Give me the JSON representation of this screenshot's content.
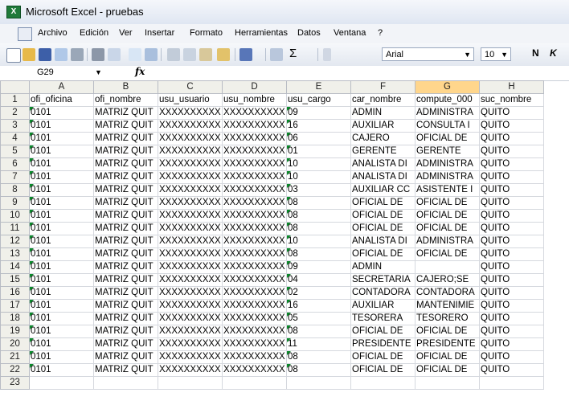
{
  "window": {
    "title": "Microsoft Excel - pruebas"
  },
  "menu": [
    "Archivo",
    "Edición",
    "Ver",
    "Insertar",
    "Formato",
    "Herramientas",
    "Datos",
    "Ventana",
    "?"
  ],
  "toolbar": {
    "font": "Arial",
    "size": "10",
    "bold": "N",
    "italic": "K",
    "sum": "Σ"
  },
  "formula_bar": {
    "cell_ref": "G29",
    "fx": "fx",
    "value": ""
  },
  "columns": [
    "A",
    "B",
    "C",
    "D",
    "E",
    "F",
    "G",
    "H"
  ],
  "rows": [
    [
      "ofi_oficina",
      "ofi_nombre",
      "usu_usuario",
      "usu_nombre",
      "usu_cargo",
      "car_nombre",
      "compute_000",
      "suc_nombre"
    ],
    [
      "0101",
      "MATRIZ QUIT",
      "XXXXXXXXXX",
      "XXXXXXXXXX",
      "09",
      "ADMIN",
      "ADMINISTRA",
      "QUITO"
    ],
    [
      "0101",
      "MATRIZ QUIT",
      "XXXXXXXXXX",
      "XXXXXXXXXX",
      "16",
      "AUXILIAR",
      "CONSULTA I",
      "QUITO"
    ],
    [
      "0101",
      "MATRIZ QUIT",
      "XXXXXXXXXX",
      "XXXXXXXXXX",
      "06",
      "CAJERO",
      "OFICIAL DE",
      "QUITO"
    ],
    [
      "0101",
      "MATRIZ QUIT",
      "XXXXXXXXXX",
      "XXXXXXXXXX",
      "01",
      "GERENTE",
      "GERENTE",
      "QUITO"
    ],
    [
      "0101",
      "MATRIZ QUIT",
      "XXXXXXXXXX",
      "XXXXXXXXXX",
      "10",
      "ANALISTA DI",
      "ADMINISTRA",
      "QUITO"
    ],
    [
      "0101",
      "MATRIZ QUIT",
      "XXXXXXXXXX",
      "XXXXXXXXXX",
      "10",
      "ANALISTA DI",
      "ADMINISTRA",
      "QUITO"
    ],
    [
      "0101",
      "MATRIZ QUIT",
      "XXXXXXXXXX",
      "XXXXXXXXXX",
      "03",
      "AUXILIAR CC",
      "ASISTENTE I",
      "QUITO"
    ],
    [
      "0101",
      "MATRIZ QUIT",
      "XXXXXXXXXX",
      "XXXXXXXXXX",
      "08",
      "OFICIAL DE",
      "OFICIAL DE",
      "QUITO"
    ],
    [
      "0101",
      "MATRIZ QUIT",
      "XXXXXXXXXX",
      "XXXXXXXXXX",
      "08",
      "OFICIAL DE",
      "OFICIAL DE",
      "QUITO"
    ],
    [
      "0101",
      "MATRIZ QUIT",
      "XXXXXXXXXX",
      "XXXXXXXXXX",
      "08",
      "OFICIAL DE",
      "OFICIAL DE",
      "QUITO"
    ],
    [
      "0101",
      "MATRIZ QUIT",
      "XXXXXXXXXX",
      "XXXXXXXXXX",
      "10",
      "ANALISTA DI",
      "ADMINISTRA",
      "QUITO"
    ],
    [
      "0101",
      "MATRIZ QUIT",
      "XXXXXXXXXX",
      "XXXXXXXXXX",
      "08",
      "OFICIAL DE",
      "OFICIAL DE",
      "QUITO"
    ],
    [
      "0101",
      "MATRIZ QUIT",
      "XXXXXXXXXX",
      "XXXXXXXXXX",
      "09",
      "ADMIN",
      "",
      "QUITO"
    ],
    [
      "0101",
      "MATRIZ QUIT",
      "XXXXXXXXXX",
      "XXXXXXXXXX",
      "04",
      "SECRETARIA",
      "CAJERO;SE",
      "QUITO"
    ],
    [
      "0101",
      "MATRIZ QUIT",
      "XXXXXXXXXX",
      "XXXXXXXXXX",
      "02",
      "CONTADORA",
      "CONTADORA",
      "QUITO"
    ],
    [
      "0101",
      "MATRIZ QUIT",
      "XXXXXXXXXX",
      "XXXXXXXXXX",
      "16",
      "AUXILIAR",
      "MANTENIMIE",
      "QUITO"
    ],
    [
      "0101",
      "MATRIZ QUIT",
      "XXXXXXXXXX",
      "XXXXXXXXXX",
      "05",
      "TESORERA",
      "TESORERO",
      "QUITO"
    ],
    [
      "0101",
      "MATRIZ QUIT",
      "XXXXXXXXXX",
      "XXXXXXXXXX",
      "08",
      "OFICIAL DE",
      "OFICIAL DE",
      "QUITO"
    ],
    [
      "0101",
      "MATRIZ QUIT",
      "XXXXXXXXXX",
      "XXXXXXXXXX",
      "11",
      "PRESIDENTE",
      "PRESIDENTE",
      "QUITO"
    ],
    [
      "0101",
      "MATRIZ QUIT",
      "XXXXXXXXXX",
      "XXXXXXXXXX",
      "08",
      "OFICIAL DE",
      "OFICIAL DE",
      "QUITO"
    ],
    [
      "0101",
      "MATRIZ QUIT",
      "XXXXXXXXXX",
      "XXXXXXXXXX",
      "08",
      "OFICIAL DE",
      "OFICIAL DE",
      "QUITO"
    ],
    [
      "",
      "",
      "",
      "",
      "",
      "",
      "",
      ""
    ]
  ],
  "colors": {
    "selected_header": "#ffd68c",
    "text_number_marker": "#0a8a2a"
  }
}
